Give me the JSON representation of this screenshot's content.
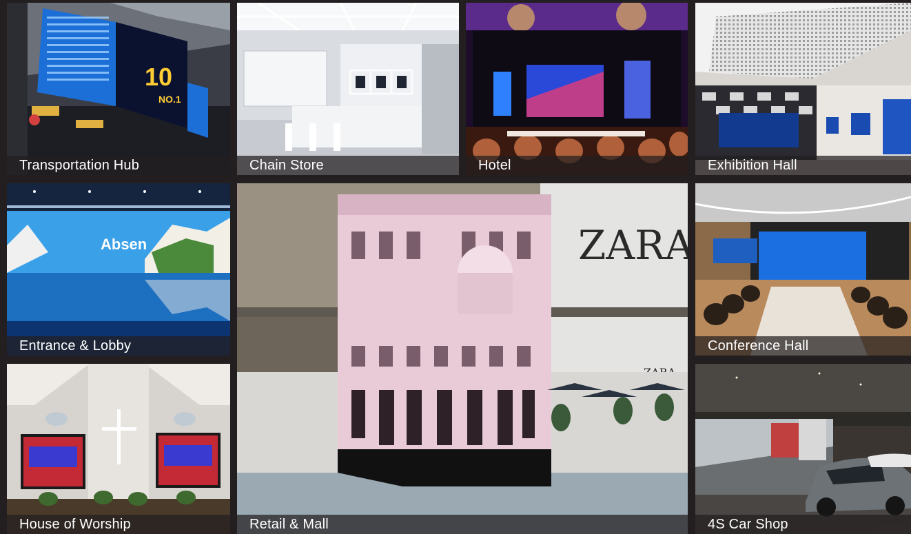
{
  "tiles": [
    {
      "id": "transport",
      "label": "Transportation Hub"
    },
    {
      "id": "chain",
      "label": "Chain Store"
    },
    {
      "id": "hotel",
      "label": "Hotel"
    },
    {
      "id": "exhibition",
      "label": "Exhibition Hall"
    },
    {
      "id": "lobby",
      "label": "Entrance & Lobby"
    },
    {
      "id": "retail",
      "label": "Retail & Mall"
    },
    {
      "id": "conference",
      "label": "Conference Hall"
    },
    {
      "id": "worship",
      "label": "House of Worship"
    },
    {
      "id": "car",
      "label": "4S Car Shop"
    }
  ],
  "scene_text": {
    "transport_big": "10",
    "transport_sub": "NO.1",
    "lobby_brand": "Absen",
    "retail_brand": "ZARA",
    "retail_brand_small": "ZARA"
  },
  "colors": {
    "background": "#231f20",
    "caption_bar": "#231f20",
    "caption_text": "#ffffff"
  }
}
